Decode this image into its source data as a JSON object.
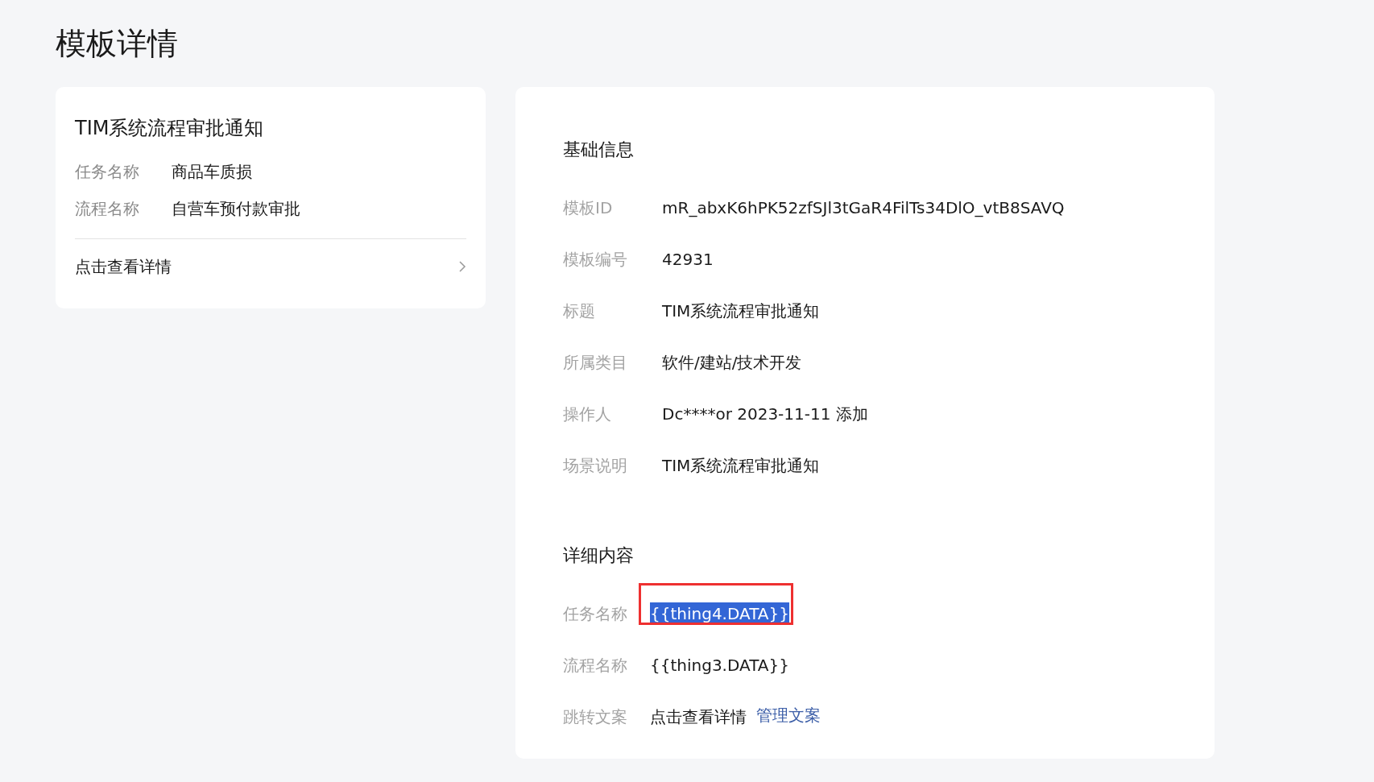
{
  "page_title": "模板详情",
  "summary_card": {
    "title": "TIM系统流程审批通知",
    "fields": [
      {
        "label": "任务名称",
        "value": "商品车质损"
      },
      {
        "label": "流程名称",
        "value": "自营车预付款审批"
      }
    ],
    "link": "点击查看详情"
  },
  "basic_info": {
    "heading": "基础信息",
    "fields": [
      {
        "label": "模板ID",
        "value": "mR_abxK6hPK52zfSJl3tGaR4FilTs34DlO_vtB8SAVQ"
      },
      {
        "label": "模板编号",
        "value": "42931"
      },
      {
        "label": "标题",
        "value": "TIM系统流程审批通知"
      },
      {
        "label": "所属类目",
        "value": "软件/建站/技术开发"
      },
      {
        "label": "操作人",
        "value": "Dc****or 2023-11-11 添加"
      },
      {
        "label": "场景说明",
        "value": "TIM系统流程审批通知"
      }
    ]
  },
  "details": {
    "heading": "详细内容",
    "fields": [
      {
        "label": "任务名称",
        "value": "{{thing4.DATA}}",
        "selected": true,
        "outlined": true
      },
      {
        "label": "流程名称",
        "value": "{{thing3.DATA}}",
        "selected": false,
        "outlined": false
      },
      {
        "label": "跳转文案",
        "value": "点击查看详情",
        "selected": false,
        "outlined": false,
        "link": "管理文案"
      }
    ]
  }
}
